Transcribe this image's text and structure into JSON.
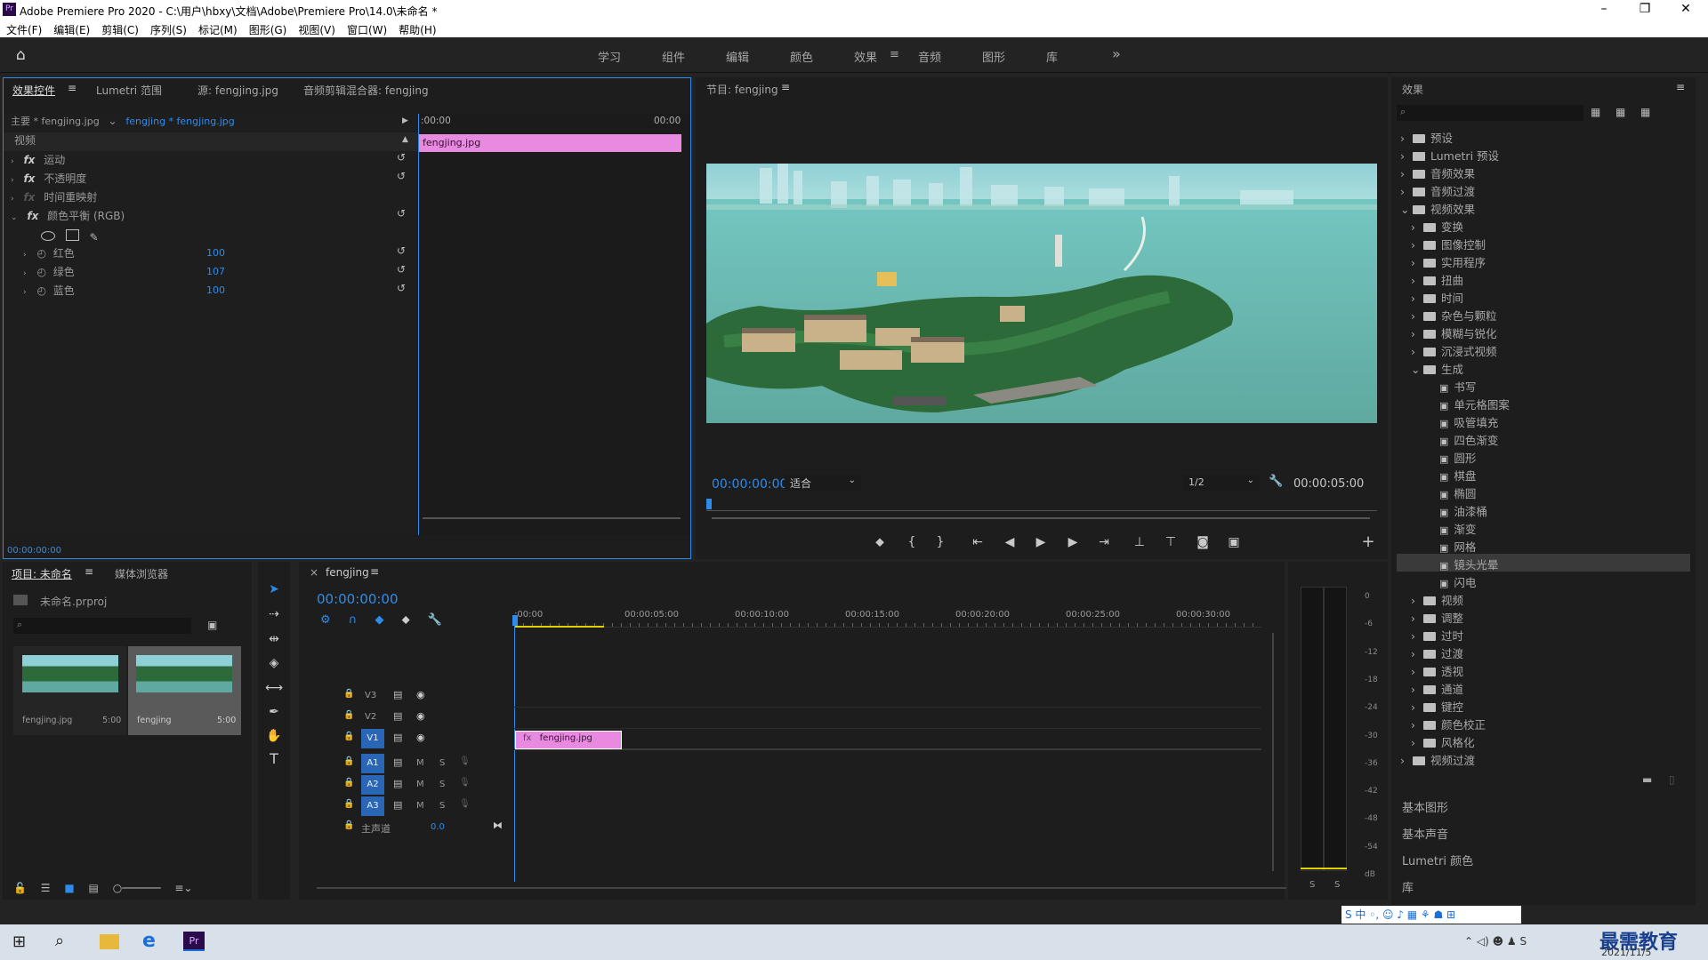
{
  "app": {
    "title": "Adobe Premiere Pro 2020 - C:\\用户\\hbxy\\文档\\Adobe\\Premiere Pro\\14.0\\未命名 *"
  },
  "menu": [
    "文件(F)",
    "编辑(E)",
    "剪辑(C)",
    "序列(S)",
    "标记(M)",
    "图形(G)",
    "视图(V)",
    "窗口(W)",
    "帮助(H)"
  ],
  "workspaces": [
    "学习",
    "组件",
    "编辑",
    "颜色",
    "效果",
    "音频",
    "图形",
    "库"
  ],
  "active_workspace": "效果",
  "effect_controls": {
    "tabs": [
      "效果控件",
      "Lumetri 范围",
      "源: fengjing.jpg",
      "音频剪辑混合器: fengjing"
    ],
    "source_master": "主要 * fengjing.jpg",
    "source_clip": "fengjing * fengjing.jpg",
    "section": "视频",
    "mini_time_start": ":00:00",
    "mini_time_end": "00:00",
    "clip_label": "fengjing.jpg",
    "effects": [
      {
        "name": "运动"
      },
      {
        "name": "不透明度"
      },
      {
        "name": "时间重映射"
      },
      {
        "name": "颜色平衡 (RGB)"
      }
    ],
    "params": [
      {
        "name": "红色",
        "value": "100"
      },
      {
        "name": "绿色",
        "value": "107"
      },
      {
        "name": "蓝色",
        "value": "100"
      }
    ],
    "timecode": "00:00:00:00"
  },
  "program": {
    "title": "节目: fengjing",
    "timecode": "00:00:00:00",
    "fit": "适合",
    "resolution": "1/2",
    "duration": "00:00:05:00"
  },
  "project": {
    "tabs": [
      "项目: 未命名",
      "媒体浏览器"
    ],
    "file": "未命名.prproj",
    "items": [
      {
        "name": "fengjing.jpg",
        "duration": "5:00"
      },
      {
        "name": "fengjing",
        "duration": "5:00"
      }
    ]
  },
  "timeline": {
    "tab": "fengjing",
    "timecode": "00:00:00:00",
    "ruler": [
      ":00:00",
      "00:00:05:00",
      "00:00:10:00",
      "00:00:15:00",
      "00:00:20:00",
      "00:00:25:00",
      "00:00:30:00"
    ],
    "video_tracks": [
      "V3",
      "V2",
      "V1"
    ],
    "audio_tracks": [
      "A1",
      "A2",
      "A3"
    ],
    "mute": "M",
    "solo": "S",
    "master": "主声道",
    "master_value": "0.0",
    "clip": "fengjing.jpg"
  },
  "meter": {
    "labels": [
      "0",
      "-6",
      "-12",
      "-18",
      "-24",
      "-30",
      "-36",
      "-42",
      "-48",
      "-54",
      "dB"
    ],
    "solo": [
      "S",
      "S"
    ]
  },
  "effects_panel": {
    "title": "效果",
    "tree": [
      {
        "label": "预设",
        "level": 0,
        "open": false
      },
      {
        "label": "Lumetri 预设",
        "level": 0,
        "open": false
      },
      {
        "label": "音频效果",
        "level": 0,
        "open": false
      },
      {
        "label": "音频过渡",
        "level": 0,
        "open": false
      },
      {
        "label": "视频效果",
        "level": 0,
        "open": true
      },
      {
        "label": "变换",
        "level": 1,
        "open": false
      },
      {
        "label": "图像控制",
        "level": 1,
        "open": false
      },
      {
        "label": "实用程序",
        "level": 1,
        "open": false
      },
      {
        "label": "扭曲",
        "level": 1,
        "open": false
      },
      {
        "label": "时间",
        "level": 1,
        "open": false
      },
      {
        "label": "杂色与颗粒",
        "level": 1,
        "open": false
      },
      {
        "label": "模糊与锐化",
        "level": 1,
        "open": false
      },
      {
        "label": "沉浸式视频",
        "level": 1,
        "open": false
      },
      {
        "label": "生成",
        "level": 1,
        "open": true
      },
      {
        "label": "书写",
        "level": 2
      },
      {
        "label": "单元格图案",
        "level": 2
      },
      {
        "label": "吸管填充",
        "level": 2
      },
      {
        "label": "四色渐变",
        "level": 2
      },
      {
        "label": "圆形",
        "level": 2
      },
      {
        "label": "棋盘",
        "level": 2
      },
      {
        "label": "椭圆",
        "level": 2
      },
      {
        "label": "油漆桶",
        "level": 2
      },
      {
        "label": "渐变",
        "level": 2
      },
      {
        "label": "网格",
        "level": 2
      },
      {
        "label": "镜头光晕",
        "level": 2,
        "selected": true
      },
      {
        "label": "闪电",
        "level": 2
      },
      {
        "label": "视频",
        "level": 1,
        "open": false
      },
      {
        "label": "调整",
        "level": 1,
        "open": false
      },
      {
        "label": "过时",
        "level": 1,
        "open": false
      },
      {
        "label": "过渡",
        "level": 1,
        "open": false
      },
      {
        "label": "透视",
        "level": 1,
        "open": false
      },
      {
        "label": "通道",
        "level": 1,
        "open": false
      },
      {
        "label": "键控",
        "level": 1,
        "open": false
      },
      {
        "label": "颜色校正",
        "level": 1,
        "open": false
      },
      {
        "label": "风格化",
        "level": 1,
        "open": false
      },
      {
        "label": "视频过渡",
        "level": 0,
        "open": false
      }
    ],
    "bottom": [
      "基本图形",
      "基本声音",
      "Lumetri 颜色",
      "库"
    ]
  },
  "taskbar": {
    "date": "2021/11/5",
    "watermark": "最需教育"
  },
  "colors": {
    "accent": "#2d8ceb",
    "clip": "#e88ae0",
    "bg": "#232323",
    "panel": "#1d1d1d"
  }
}
